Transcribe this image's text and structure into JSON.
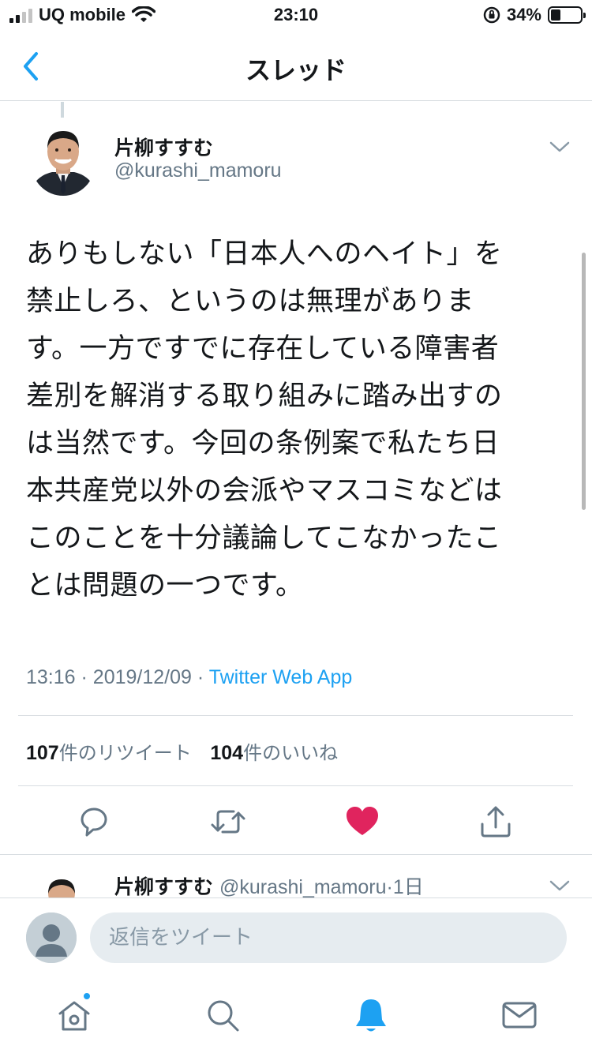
{
  "status_bar": {
    "carrier": "UQ mobile",
    "time": "23:10",
    "battery": "34%",
    "battery_level": 0.34
  },
  "nav": {
    "title": "スレッド"
  },
  "tweet": {
    "author_name": "片柳すすむ",
    "author_handle": "@kurashi_mamoru",
    "lines": [
      "ありもしない「日本人へのヘイト」を",
      "禁止しろ、というのは無理がありま",
      "す。一方ですでに存在している障害者",
      "差別を解消する取り組みに踏み出すの",
      "は当然です。今回の条例案で私たち日",
      "本共産党以外の会派やマスコミなどは",
      "このことを十分議論してこなかったこ",
      "とは問題の一つです。"
    ],
    "time": "13:16",
    "date": "2019/12/09",
    "separator": "·",
    "source": "Twitter Web App",
    "retweet_count": "107",
    "retweet_label": "件のリツイート",
    "like_count": "104",
    "like_label": "件のいいね"
  },
  "actions": {
    "icons": [
      "reply-icon",
      "retweet-icon",
      "like-icon",
      "share-icon"
    ],
    "like_color": "#e0245e"
  },
  "next_reply": {
    "author_name": "片柳すすむ",
    "author_handle": "@kurashi_mamoru",
    "separator": "·",
    "age": "1日"
  },
  "composer": {
    "placeholder": "返信をツイート"
  },
  "tab_bar": {
    "icons": [
      "home-icon",
      "search-icon",
      "notifications-icon",
      "messages-icon"
    ],
    "accent": "#1da1f2"
  }
}
